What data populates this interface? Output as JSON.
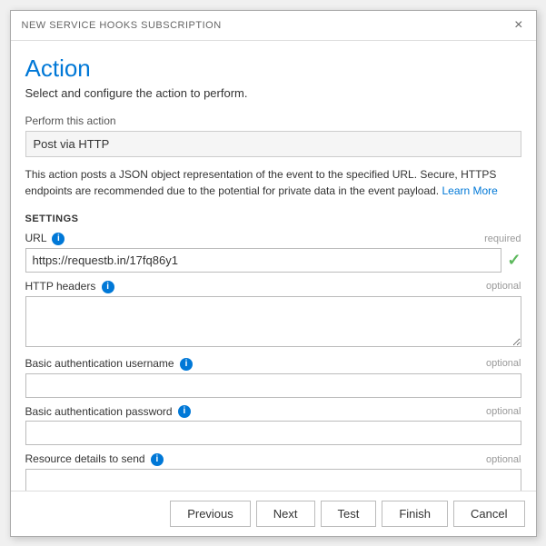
{
  "dialog": {
    "title": "NEW SERVICE HOOKS SUBSCRIPTION",
    "close_label": "×"
  },
  "page": {
    "heading": "Action",
    "subtitle": "Select and configure the action to perform."
  },
  "perform_action": {
    "label": "Perform this action",
    "value": "Post via HTTP"
  },
  "description": {
    "text": "This action posts a JSON object representation of the event to the specified URL. Secure, HTTPS endpoints are recommended due to the potential for private data in the event payload.",
    "learn_more_label": "Learn More"
  },
  "settings": {
    "heading": "SETTINGS"
  },
  "fields": {
    "url": {
      "label": "URL",
      "badge": "required",
      "value": "https://requestb.in/17fq86y1",
      "placeholder": ""
    },
    "http_headers": {
      "label": "HTTP headers",
      "badge": "optional",
      "value": "",
      "placeholder": ""
    },
    "auth_username": {
      "label": "Basic authentication username",
      "badge": "optional",
      "value": "",
      "placeholder": ""
    },
    "auth_password": {
      "label": "Basic authentication password",
      "badge": "optional",
      "value": "",
      "placeholder": ""
    },
    "resource_details": {
      "label": "Resource details to send",
      "badge": "optional",
      "value": "",
      "placeholder": ""
    }
  },
  "footer": {
    "previous_label": "Previous",
    "next_label": "Next",
    "test_label": "Test",
    "finish_label": "Finish",
    "cancel_label": "Cancel"
  },
  "icons": {
    "info": "i",
    "check": "✓"
  }
}
